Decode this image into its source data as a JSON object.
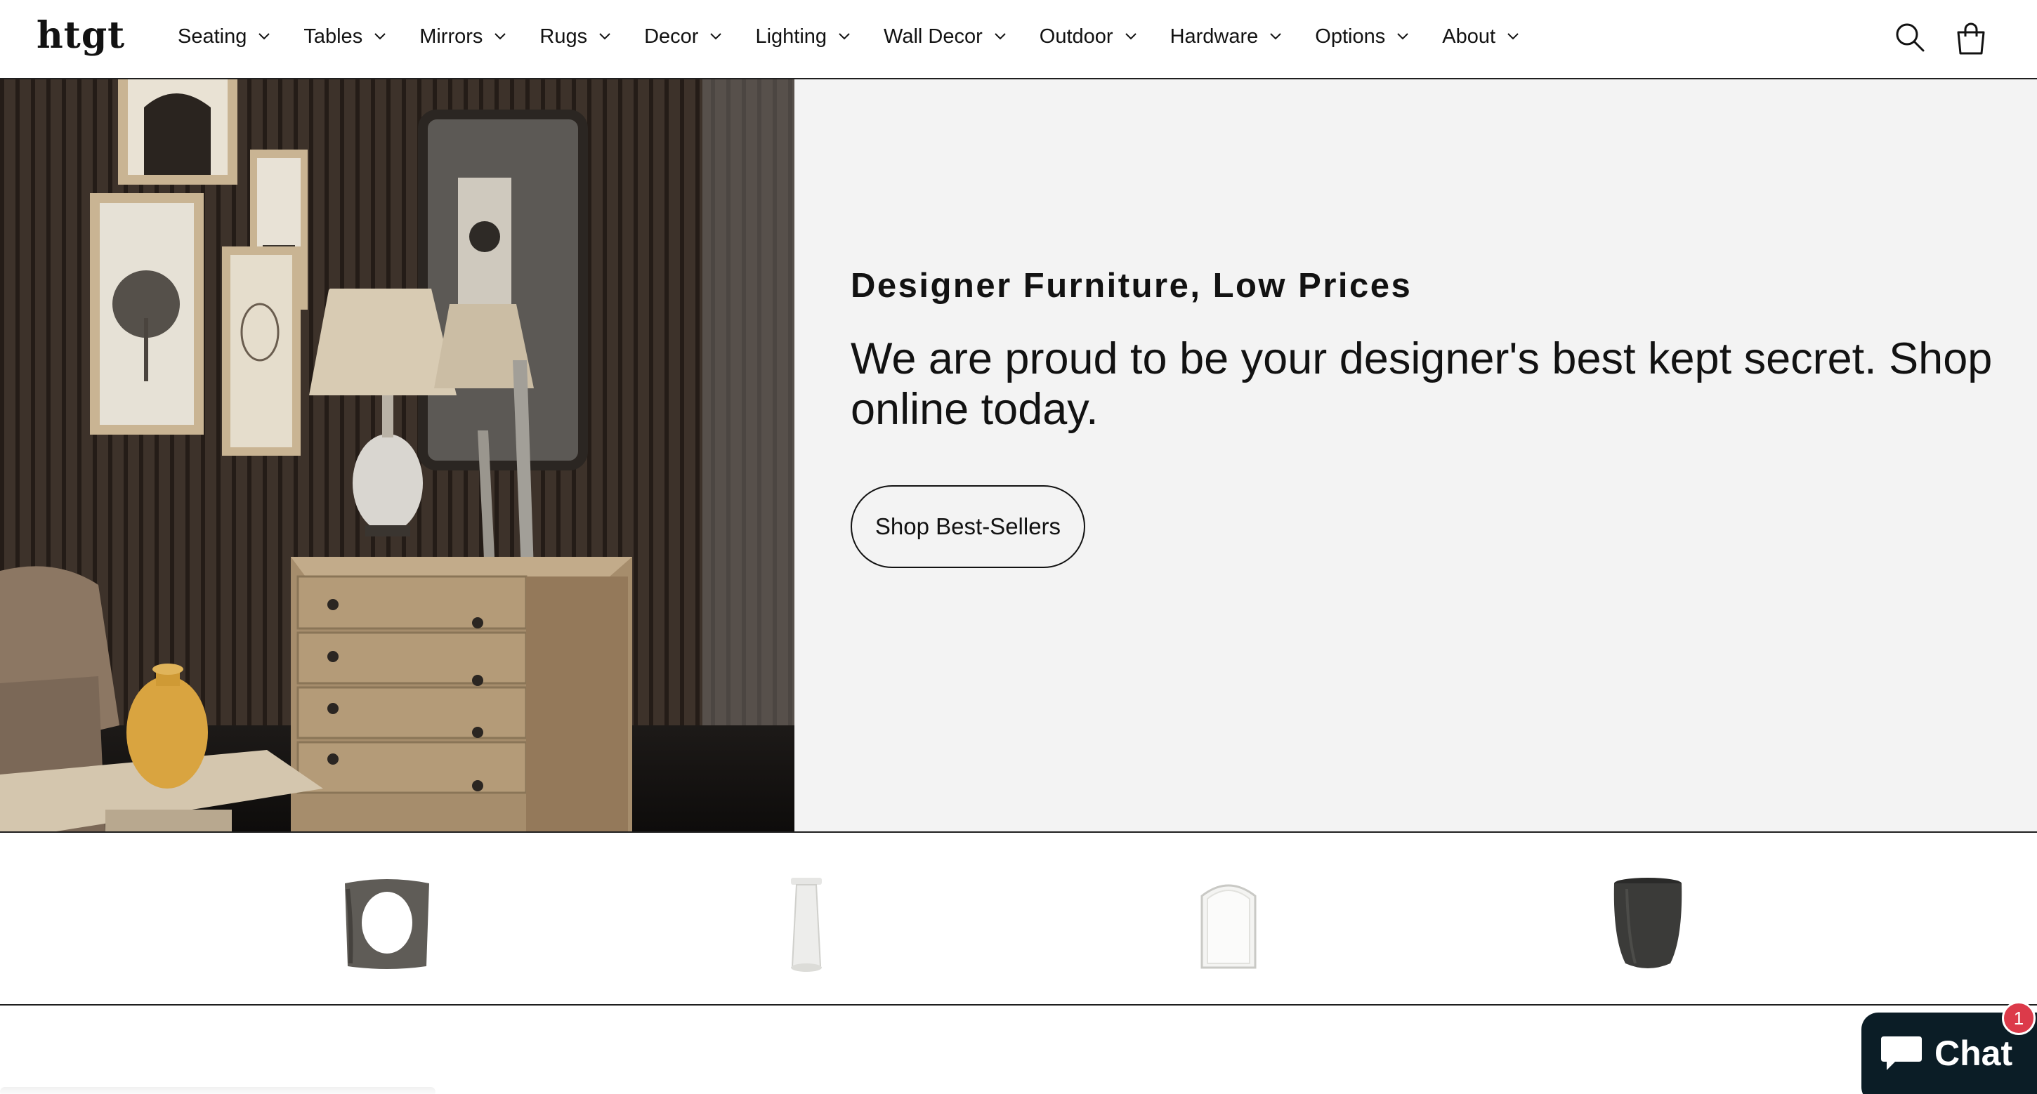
{
  "brand": {
    "logo": "htgt"
  },
  "nav": {
    "items": [
      {
        "label": "Seating"
      },
      {
        "label": "Tables"
      },
      {
        "label": "Mirrors"
      },
      {
        "label": "Rugs"
      },
      {
        "label": "Decor"
      },
      {
        "label": "Lighting"
      },
      {
        "label": "Wall Decor"
      },
      {
        "label": "Outdoor"
      },
      {
        "label": "Hardware"
      },
      {
        "label": "Options"
      },
      {
        "label": "About"
      }
    ]
  },
  "header_icons": {
    "search": "search-icon",
    "cart": "cart-icon"
  },
  "hero": {
    "subheading": "Designer Furniture, Low Prices",
    "text": "We are proud to be your designer's best kept secret. Shop online today.",
    "button_label": "Shop Best-Sellers"
  },
  "products": [
    {
      "icon": "cutout-stool-image"
    },
    {
      "icon": "pedestal-table-image"
    },
    {
      "icon": "arched-mirror-image"
    },
    {
      "icon": "drum-side-table-image"
    }
  ],
  "chat": {
    "label": "Chat",
    "badge": "1"
  },
  "colors": {
    "text": "#121212",
    "panel": "#f3f3f3",
    "chat_bg": "#0b1d26",
    "badge": "#dc3a4a"
  }
}
